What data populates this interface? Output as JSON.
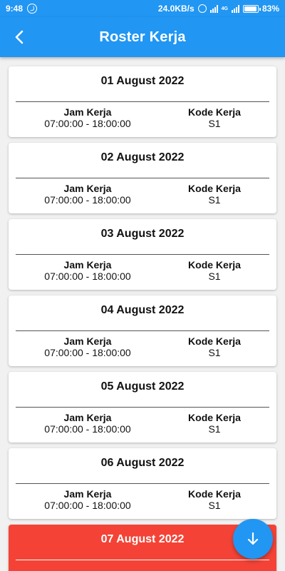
{
  "status_bar": {
    "time": "9:48",
    "net_speed": "24.0KB/s",
    "battery": "83%",
    "net_type": "4G"
  },
  "app_bar": {
    "title": "Roster Kerja",
    "back_icon": "arrow-back-icon"
  },
  "labels": {
    "jam": "Jam Kerja",
    "kode": "Kode Kerja"
  },
  "roster": [
    {
      "date": "01 August 2022",
      "jam": "07:00:00 - 18:00:00",
      "kode": "S1"
    },
    {
      "date": "02 August 2022",
      "jam": "07:00:00 - 18:00:00",
      "kode": "S1"
    },
    {
      "date": "03 August 2022",
      "jam": "07:00:00 - 18:00:00",
      "kode": "S1"
    },
    {
      "date": "04 August 2022",
      "jam": "07:00:00 - 18:00:00",
      "kode": "S1"
    },
    {
      "date": "05 August 2022",
      "jam": "07:00:00 - 18:00:00",
      "kode": "S1"
    },
    {
      "date": "06 August 2022",
      "jam": "07:00:00 - 18:00:00",
      "kode": "S1"
    },
    {
      "date": "07 August 2022",
      "jam": "",
      "kode": "",
      "highlight": true
    }
  ],
  "fab": {
    "icon": "arrow-down-icon"
  },
  "colors": {
    "primary": "#2196f3",
    "highlight": "#f44336"
  }
}
